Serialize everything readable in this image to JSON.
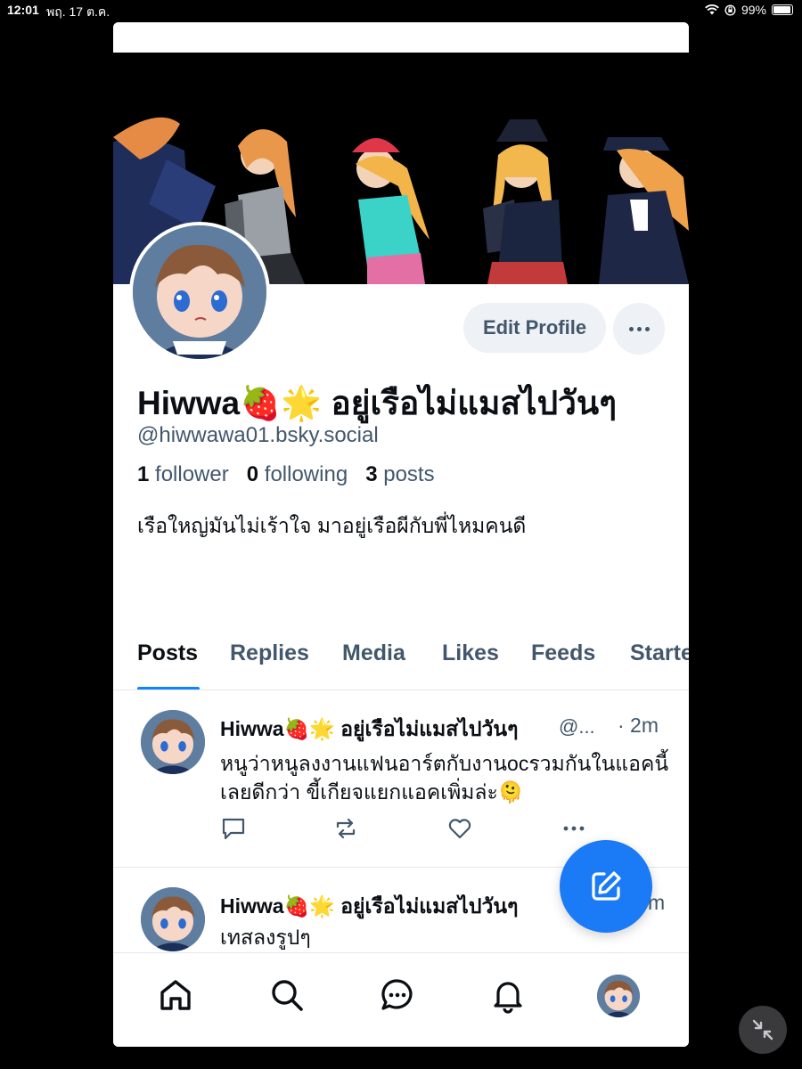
{
  "status_bar": {
    "time": "12:01",
    "date": "พฤ. 17 ต.ค.",
    "battery": "99%"
  },
  "profile": {
    "display_name": "Hiwwa🍓🌟 อยู่เรือไม่แมสไปวันๆ",
    "handle": "@hiwwawa01.bsky.social",
    "followers_count": "1",
    "followers_label": "follower",
    "following_count": "0",
    "following_label": "following",
    "posts_count": "3",
    "posts_label": "posts",
    "bio": "เรือใหญ่มันไม่เร้าใจ มาอยู่เรือผีกับพี่ไหมคนดี",
    "edit_label": "Edit Profile"
  },
  "tabs": [
    "Posts",
    "Replies",
    "Media",
    "Likes",
    "Feeds",
    "Starter Packs"
  ],
  "posts": [
    {
      "author": "Hiwwa🍓🌟 อยู่เรือไม่แมสไปวันๆ",
      "handle": "@...",
      "time": "· 2m",
      "text": "หนูว่าหนูลงงานแฟนอาร์ตกับงานocรวมกันในแอคนี้เลยดีกว่า ขี้เกียจแยกแอคเพิ่มล่ะ🫠"
    },
    {
      "author": "Hiwwa🍓🌟 อยู่เรือไม่แมสไปวันๆ",
      "handle": "",
      "time": "m",
      "text": "เทสลงรูปๆ"
    }
  ],
  "icons": {
    "reply": "reply-icon",
    "repost": "repost-icon",
    "like": "heart-icon",
    "more": "more-dots-icon",
    "compose": "compose-icon",
    "home": "home-icon",
    "search": "search-icon",
    "chat": "chat-icon",
    "notifications": "bell-icon",
    "collapse": "collapse-icon"
  },
  "colors": {
    "accent": "#1083fe",
    "fab": "#1b7af6",
    "muted_text": "#42576c"
  }
}
